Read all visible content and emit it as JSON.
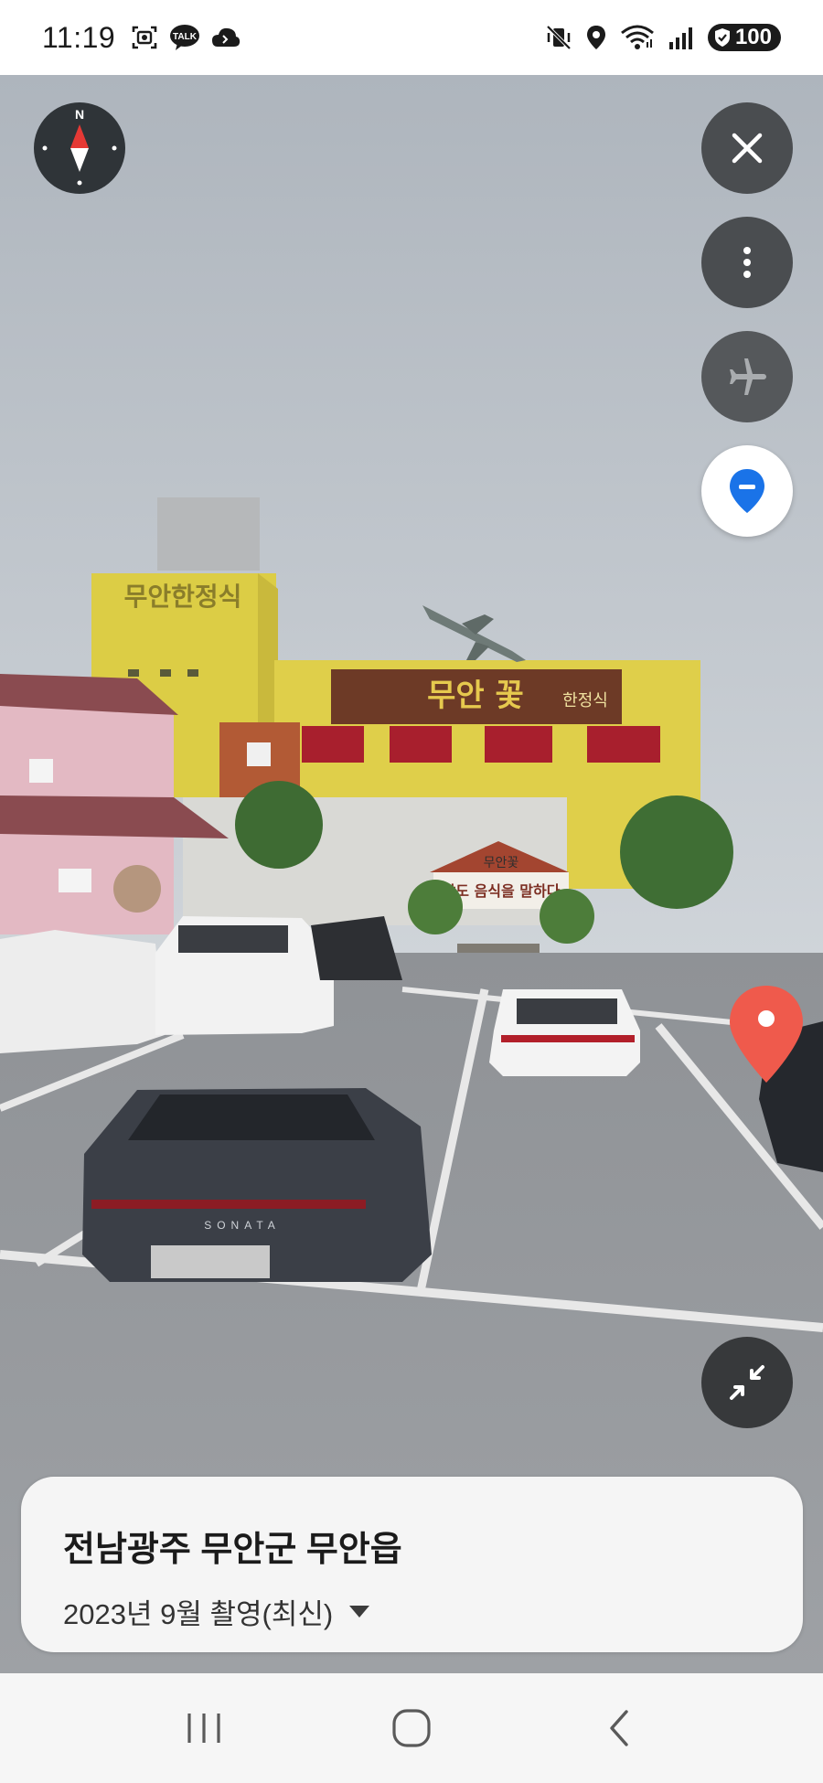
{
  "status_bar": {
    "time": "11:19",
    "left_icons": [
      "screenshot-icon",
      "kakaotalk-icon",
      "cloud-icon"
    ],
    "right_icons": [
      "mute-vibrate-icon",
      "location-icon",
      "wifi-icon",
      "signal-icon"
    ],
    "talk_badge": "TALK",
    "battery_level": "100"
  },
  "street_view": {
    "sign_main": "무안 꽃",
    "sign_sub": "한정식",
    "sign_tower": "무안한정식",
    "entrance_banner": "남도 음식을 말하다",
    "entrance_logo": "무안꽃",
    "car_badge": "SONATA"
  },
  "controls": {
    "compass_label": "N",
    "close_icon": "close-icon",
    "more_icon": "more-vertical-icon",
    "airplane_icon": "airplane-icon",
    "location_icon": "location-pin-icon",
    "collapse_icon": "collapse-icon"
  },
  "info_card": {
    "title": "전남광주 무안군 무안읍",
    "date": "2023년 9월 촬영(최신)"
  },
  "colors": {
    "marker": "#ef5a4c",
    "location_blue": "#1a73e8",
    "fab_gray": "#4a4d50"
  }
}
